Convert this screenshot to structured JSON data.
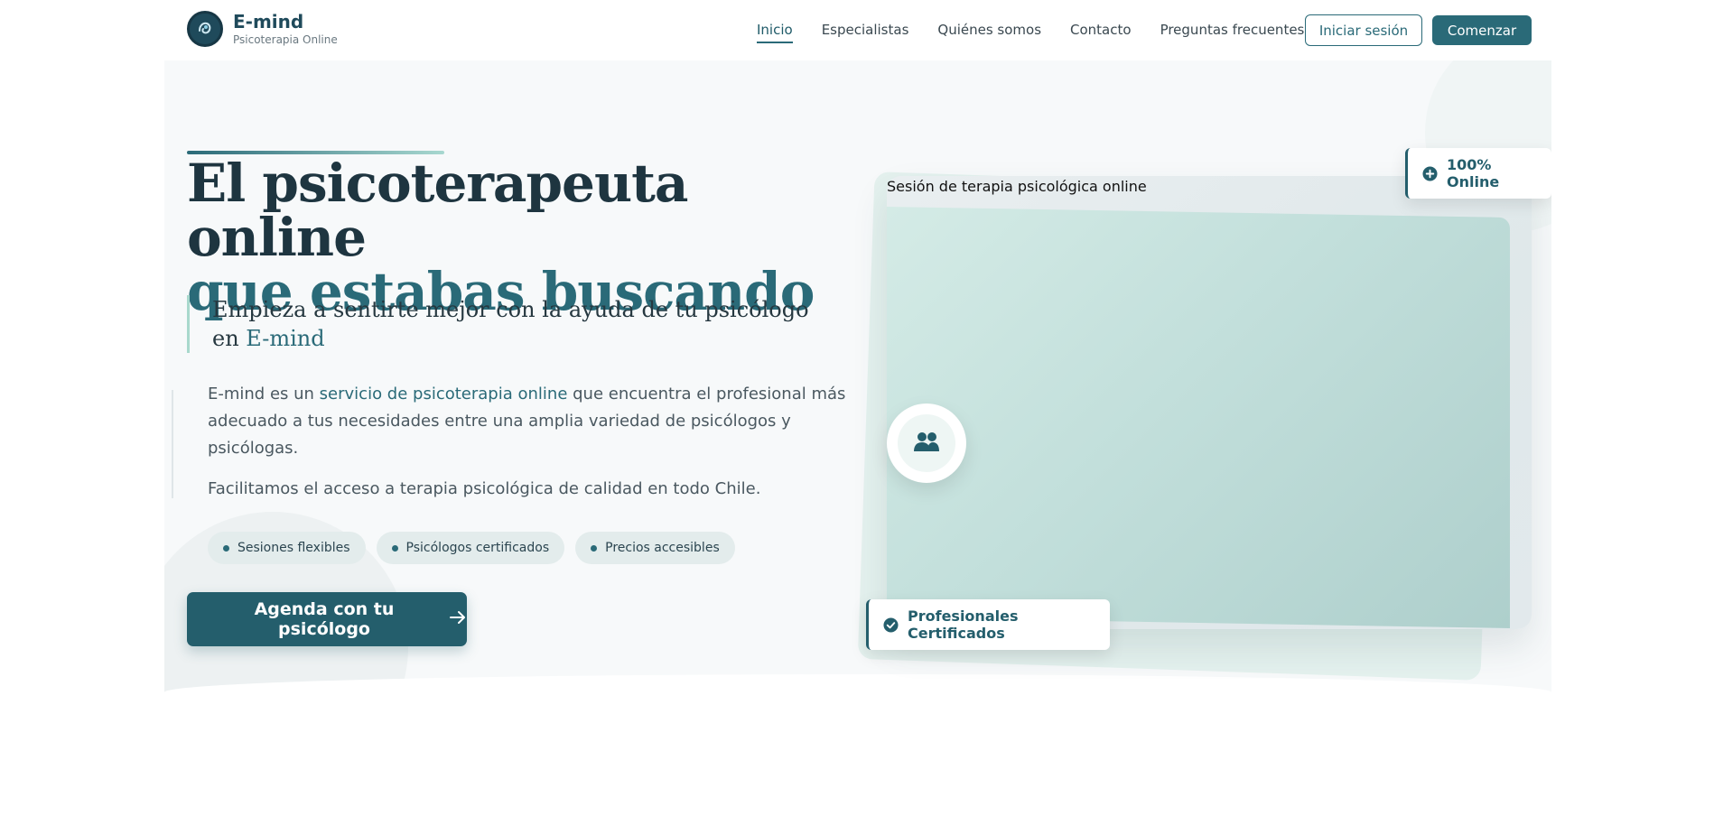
{
  "brand": {
    "name": "E-mind",
    "subtitle": "Psicoterapia Online"
  },
  "nav": {
    "links": [
      "Inicio",
      "Especialistas",
      "Quiénes somos",
      "Contacto",
      "Preguntas frecuentes"
    ],
    "active": "Inicio",
    "login_label": "Iniciar sesión",
    "start_label": "Comenzar"
  },
  "hero": {
    "headline_part1": "El psicoterapeuta online",
    "headline_part2_plain": "que ",
    "headline_part2_accent": "estabas buscando",
    "quote_plain": "Empieza a sentirte mejor con la ayuda de tu psicólogo en ",
    "quote_accent": "E-mind",
    "desc_pre": "E-mind es un ",
    "desc_strong": "servicio de psicoterapia online",
    "desc_post": " que encuentra el profesional más adecuado a tus necesidades entre una amplia variedad de psicólogos y psicólogas.",
    "desc2": "Facilitamos el acceso a terapia psicológica de calidad en todo Chile.",
    "chips": [
      "Sesiones flexibles",
      "Psicólogos certificados",
      "Precios accesibles"
    ],
    "cta_label": "Agenda con tu psicólogo",
    "image_alt": "Sesión de terapia psicológica online",
    "badge_online": "100% Online",
    "badge_cert": "Profesionales Certificados"
  },
  "colors": {
    "primary": "#2a6a78",
    "dark": "#1e3540",
    "accent_soft": "#a8d8cc"
  },
  "icons": {
    "logo": "brain-hand-icon",
    "users": "users-icon",
    "plus": "plus-circle-icon",
    "check": "check-circle-icon",
    "arrow": "arrow-right-icon"
  }
}
